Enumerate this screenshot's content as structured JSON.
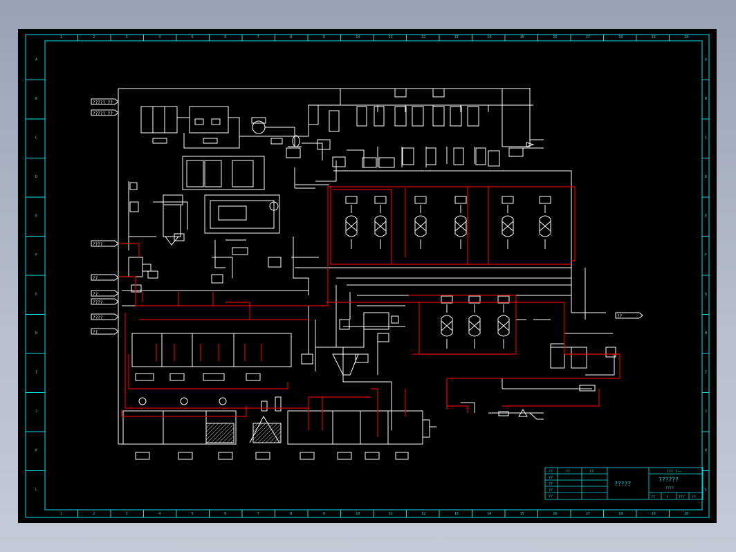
{
  "frame": {
    "columns": [
      "1",
      "2",
      "3",
      "4",
      "5",
      "6",
      "7",
      "8",
      "9",
      "10",
      "11",
      "12",
      "13",
      "14",
      "15",
      "16",
      "17",
      "18",
      "19",
      "20"
    ],
    "rows": [
      "A",
      "B",
      "C",
      "D",
      "E",
      "F",
      "G",
      "H",
      "I",
      "J",
      "K",
      "L"
    ]
  },
  "title_block": {
    "left_labels": [
      "??",
      "??",
      "??",
      "??",
      "??"
    ],
    "header_cells": [
      "??",
      "??"
    ],
    "center_text": "?????",
    "top_right": "??? ?——",
    "right_title": "??????",
    "right_sub": "????",
    "bottom_cells": [
      "??",
      "?",
      "???",
      "??"
    ]
  },
  "streams": {
    "inlets_top": [
      "????? ??",
      "????? ??"
    ],
    "inlets_left": [
      "????",
      "??",
      "??",
      "????",
      "????",
      "??"
    ],
    "outlets_right": [
      "??"
    ]
  },
  "colors": {
    "page_bg": "#a3acbb",
    "sheet": "#000000",
    "frame": "#00e5ee",
    "process_line": "#ffffff",
    "highlight_line": "#e00000"
  }
}
